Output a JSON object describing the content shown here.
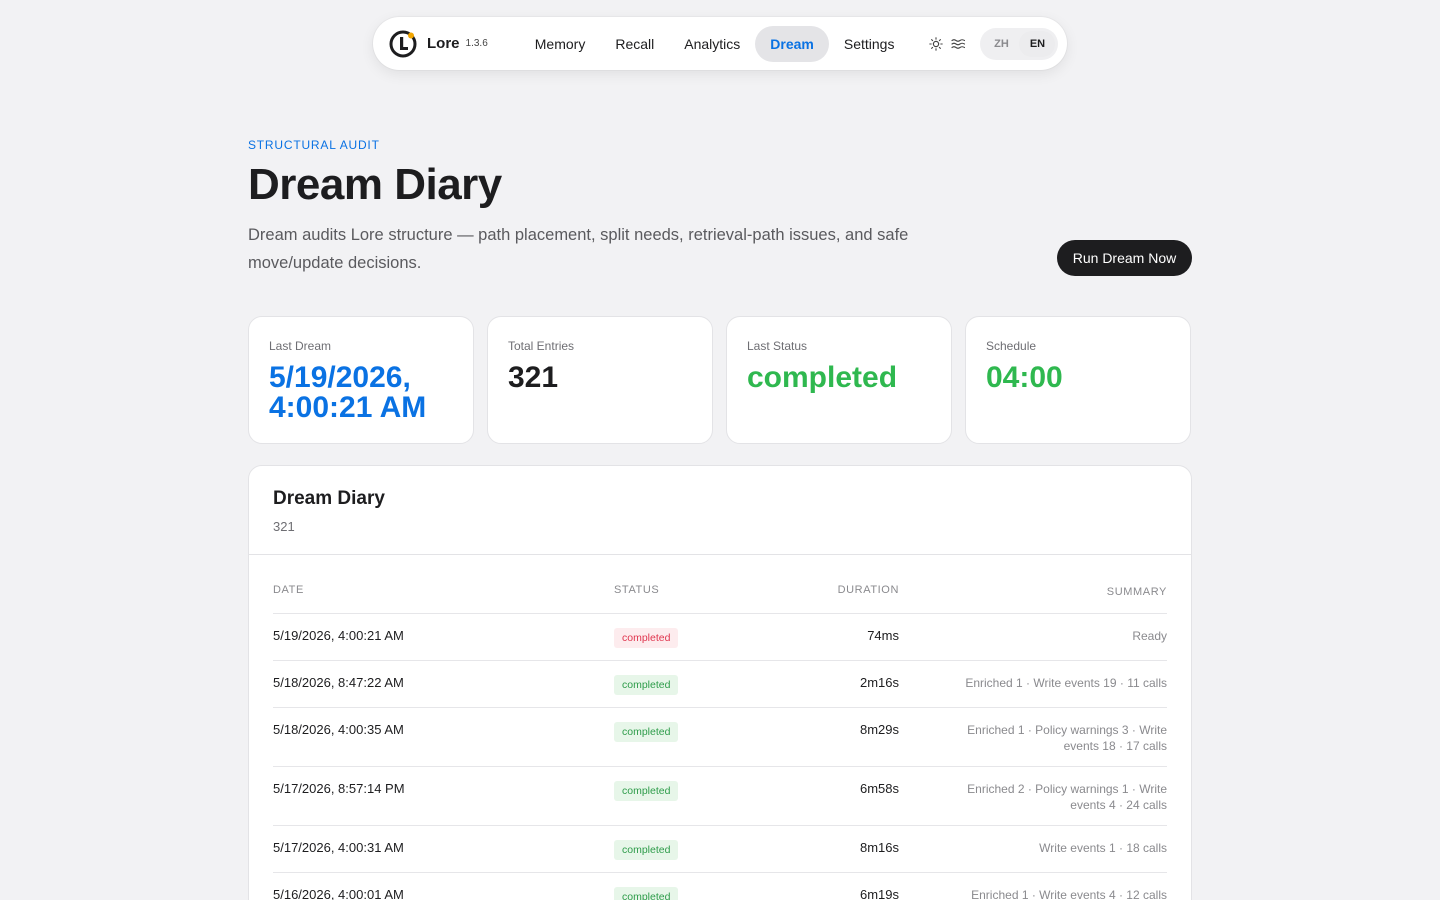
{
  "nav": {
    "brand": "Lore",
    "version": "1.3.6",
    "tabs": [
      {
        "label": "Memory",
        "active": false
      },
      {
        "label": "Recall",
        "active": false
      },
      {
        "label": "Analytics",
        "active": false
      },
      {
        "label": "Dream",
        "active": true
      },
      {
        "label": "Settings",
        "active": false
      }
    ],
    "icons": [
      "sun-icon",
      "waves-icon"
    ],
    "lang": {
      "zh": "ZH",
      "en": "EN",
      "selected": "EN"
    }
  },
  "header": {
    "eyebrow": "STRUCTURAL AUDIT",
    "title": "Dream Diary",
    "description": "Dream audits Lore structure — path placement, split needs, retrieval-path issues, and safe move/update decisions.",
    "run_button": "Run Dream Now"
  },
  "stats": [
    {
      "label": "Last Dream",
      "value": "5/19/2026, 4:00:21 AM"
    },
    {
      "label": "Total Entries",
      "value": "321"
    },
    {
      "label": "Last Status",
      "value": "completed"
    },
    {
      "label": "Schedule",
      "value": "04:00"
    }
  ],
  "diary": {
    "title": "Dream Diary",
    "count": "321",
    "columns": {
      "date": "DATE",
      "status": "STATUS",
      "duration": "DURATION",
      "summary": "SUMMARY"
    },
    "rows": [
      {
        "date": "5/19/2026, 4:00:21 AM",
        "status": "completed",
        "duration": "74ms",
        "summary": "Ready",
        "status_tone": "red"
      },
      {
        "date": "5/18/2026, 8:47:22 AM",
        "status": "completed",
        "duration": "2m16s",
        "summary": "Enriched 1 · Write events 19 · 11 calls",
        "status_tone": "green"
      },
      {
        "date": "5/18/2026, 4:00:35 AM",
        "status": "completed",
        "duration": "8m29s",
        "summary": "Enriched 1 · Policy warnings 3 · Write events 18 · 17 calls",
        "status_tone": "green"
      },
      {
        "date": "5/17/2026, 8:57:14 PM",
        "status": "completed",
        "duration": "6m58s",
        "summary": "Enriched 2 · Policy warnings 1 · Write events 4 · 24 calls",
        "status_tone": "green"
      },
      {
        "date": "5/17/2026, 4:00:31 AM",
        "status": "completed",
        "duration": "8m16s",
        "summary": "Write events 1 · 18 calls",
        "status_tone": "green"
      },
      {
        "date": "5/16/2026, 4:00:01 AM",
        "status": "completed",
        "duration": "6m19s",
        "summary": "Enriched 1 · Write events 4 · 12 calls",
        "status_tone": "green"
      }
    ]
  },
  "colors": {
    "accent": "#0a72e3",
    "success": "#2fb84f",
    "danger": "#e0364f",
    "logo_dot": "#f2a600"
  }
}
